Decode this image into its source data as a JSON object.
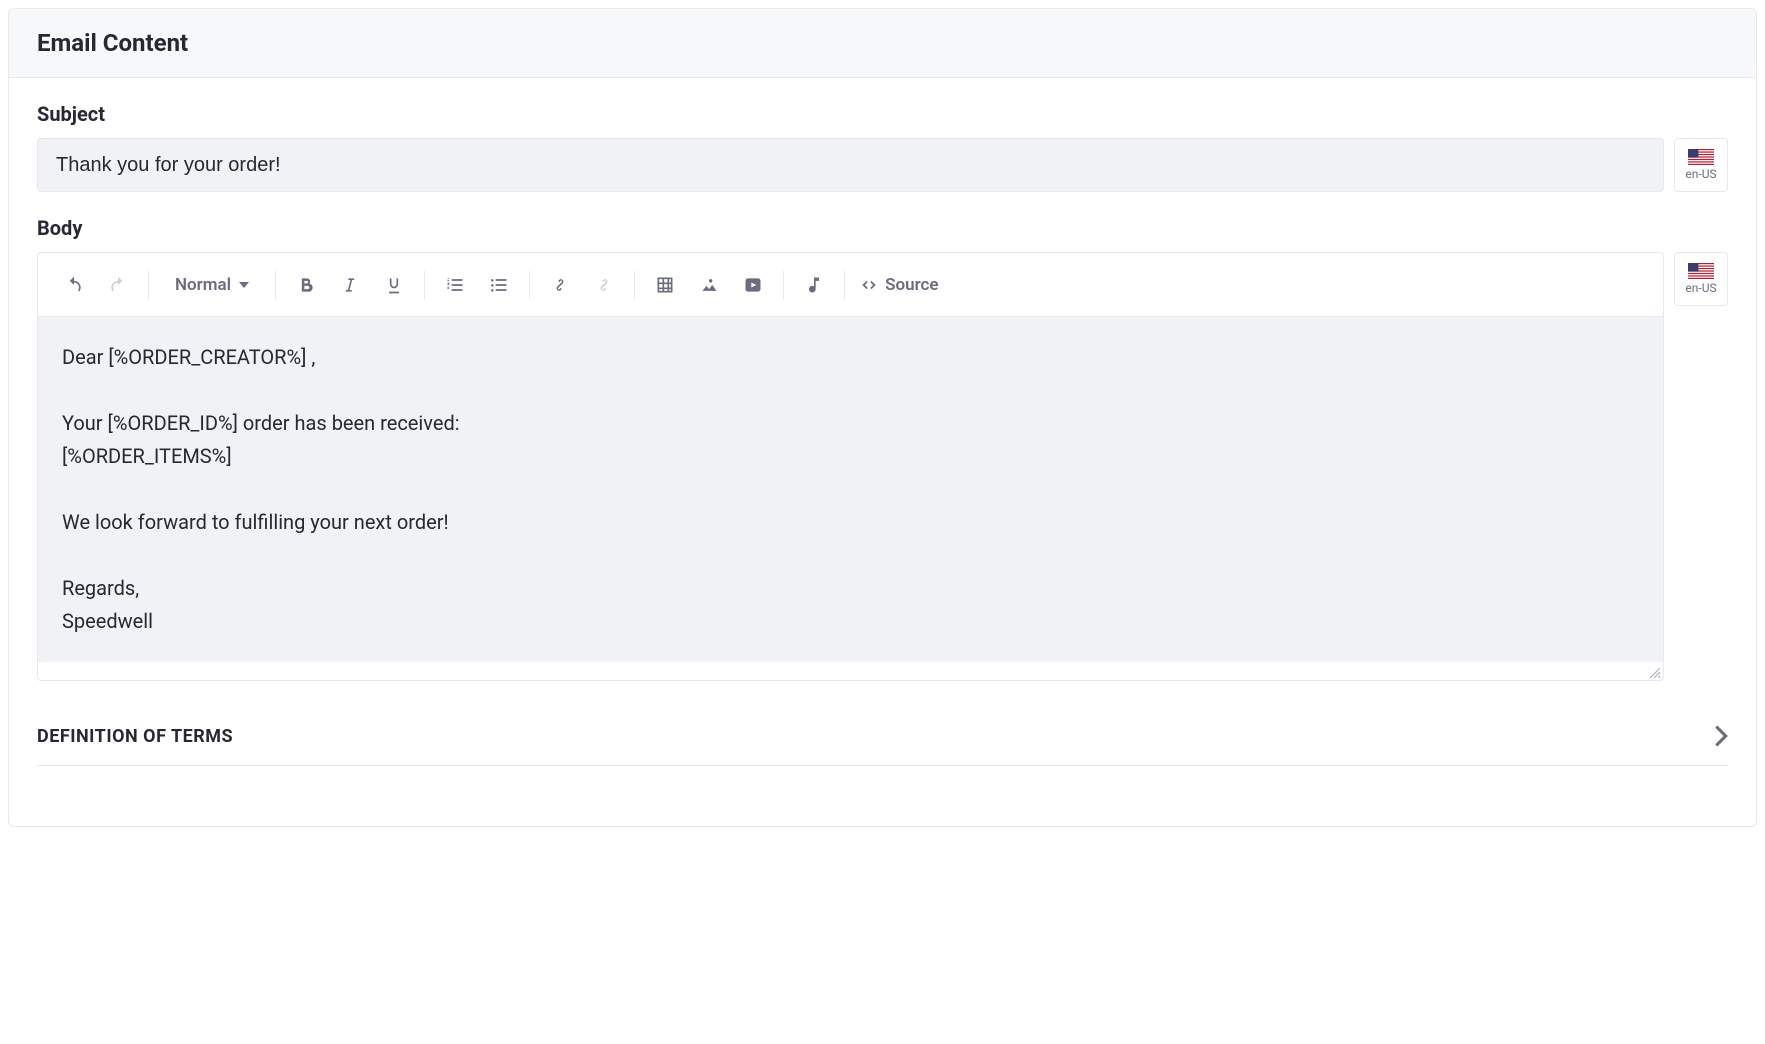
{
  "panel": {
    "title": "Email Content"
  },
  "subject": {
    "label": "Subject",
    "value": "Thank you for your order!",
    "locale": "en-US"
  },
  "body": {
    "label": "Body",
    "locale": "en-US",
    "styleDropdown": "Normal",
    "sourceLabel": "Source",
    "content": {
      "line1": "Dear [%ORDER_CREATOR%] ,",
      "line2": "",
      "line3": "Your [%ORDER_ID%] order has been received:",
      "line4": "[%ORDER_ITEMS%]",
      "line5": "",
      "line6": "We look forward to fulfilling your next order!",
      "line7": "",
      "line8": "Regards,",
      "line9": "Speedwell"
    }
  },
  "accordion": {
    "definitionOfTerms": "DEFINITION OF TERMS"
  }
}
